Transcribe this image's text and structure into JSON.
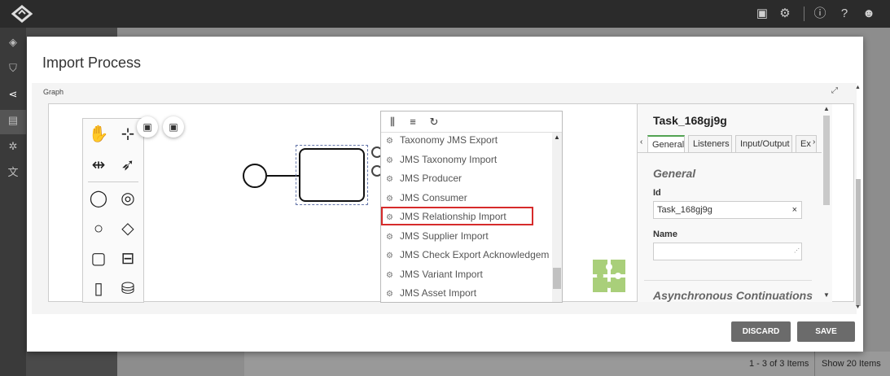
{
  "topbar": {
    "icons": [
      "logo-icon",
      "briefcase-icon",
      "gear-icon",
      "info-icon",
      "help-icon",
      "user-icon"
    ]
  },
  "leftnav": {
    "icons": [
      "cube-icon",
      "shield-icon",
      "share-icon",
      "search-doc-icon",
      "cogs-icon",
      "translate-icon"
    ]
  },
  "background": {
    "pagination": "1 - 3 of 3 Items",
    "show_items": "Show 20 Items"
  },
  "modal": {
    "title": "Import Process",
    "graph_label": "Graph",
    "discard_label": "DISCARD",
    "save_label": "SAVE"
  },
  "dropdown": {
    "items": [
      "Taxonomy JMS Export",
      "JMS Taxonomy Import",
      "JMS Producer",
      "JMS Consumer",
      "JMS Relationship Import",
      "JMS Supplier Import",
      "JMS Check Export Acknowledgement",
      "JMS Variant Import",
      "JMS Asset Import"
    ],
    "highlighted": "JMS Relationship Import"
  },
  "properties": {
    "title": "Task_168gj9g",
    "tabs": [
      "General",
      "Listeners",
      "Input/Output",
      "Ex"
    ],
    "active_tab": "General",
    "section_general": "General",
    "id_label": "Id",
    "id_value": "Task_168gj9g",
    "name_label": "Name",
    "name_value": "",
    "section_async": "Asynchronous Continuations"
  },
  "colors": {
    "highlight": "#d62b2b",
    "tab_accent": "#52a352",
    "puzzle": "#a9cf7a"
  }
}
